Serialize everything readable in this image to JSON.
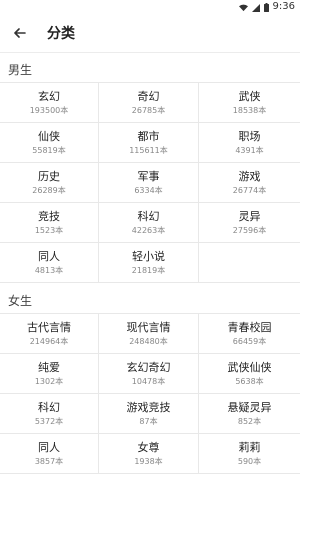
{
  "status_bar": {
    "time": "9:36"
  },
  "app_bar": {
    "title": "分类"
  },
  "sections": {
    "male": {
      "title": "男生",
      "items": [
        {
          "name": "玄幻",
          "count": "193500本"
        },
        {
          "name": "奇幻",
          "count": "26785本"
        },
        {
          "name": "武侠",
          "count": "18538本"
        },
        {
          "name": "仙侠",
          "count": "55819本"
        },
        {
          "name": "都市",
          "count": "115611本"
        },
        {
          "name": "职场",
          "count": "4391本"
        },
        {
          "name": "历史",
          "count": "26289本"
        },
        {
          "name": "军事",
          "count": "6334本"
        },
        {
          "name": "游戏",
          "count": "26774本"
        },
        {
          "name": "竞技",
          "count": "1523本"
        },
        {
          "name": "科幻",
          "count": "42263本"
        },
        {
          "name": "灵异",
          "count": "27596本"
        },
        {
          "name": "同人",
          "count": "4813本"
        },
        {
          "name": "轻小说",
          "count": "21819本"
        }
      ]
    },
    "female": {
      "title": "女生",
      "items": [
        {
          "name": "古代言情",
          "count": "214964本"
        },
        {
          "name": "现代言情",
          "count": "248480本"
        },
        {
          "name": "青春校园",
          "count": "66459本"
        },
        {
          "name": "纯爱",
          "count": "1302本"
        },
        {
          "name": "玄幻奇幻",
          "count": "10478本"
        },
        {
          "name": "武侠仙侠",
          "count": "5638本"
        },
        {
          "name": "科幻",
          "count": "5372本"
        },
        {
          "name": "游戏竞技",
          "count": "87本"
        },
        {
          "name": "悬疑灵异",
          "count": "852本"
        },
        {
          "name": "同人",
          "count": "3857本"
        },
        {
          "name": "女尊",
          "count": "1938本"
        },
        {
          "name": "莉莉",
          "count": "590本"
        }
      ]
    }
  },
  "icons": {
    "wifi": "wifi-icon",
    "signal": "signal-icon",
    "battery": "battery-icon",
    "back": "back-arrow-icon"
  }
}
